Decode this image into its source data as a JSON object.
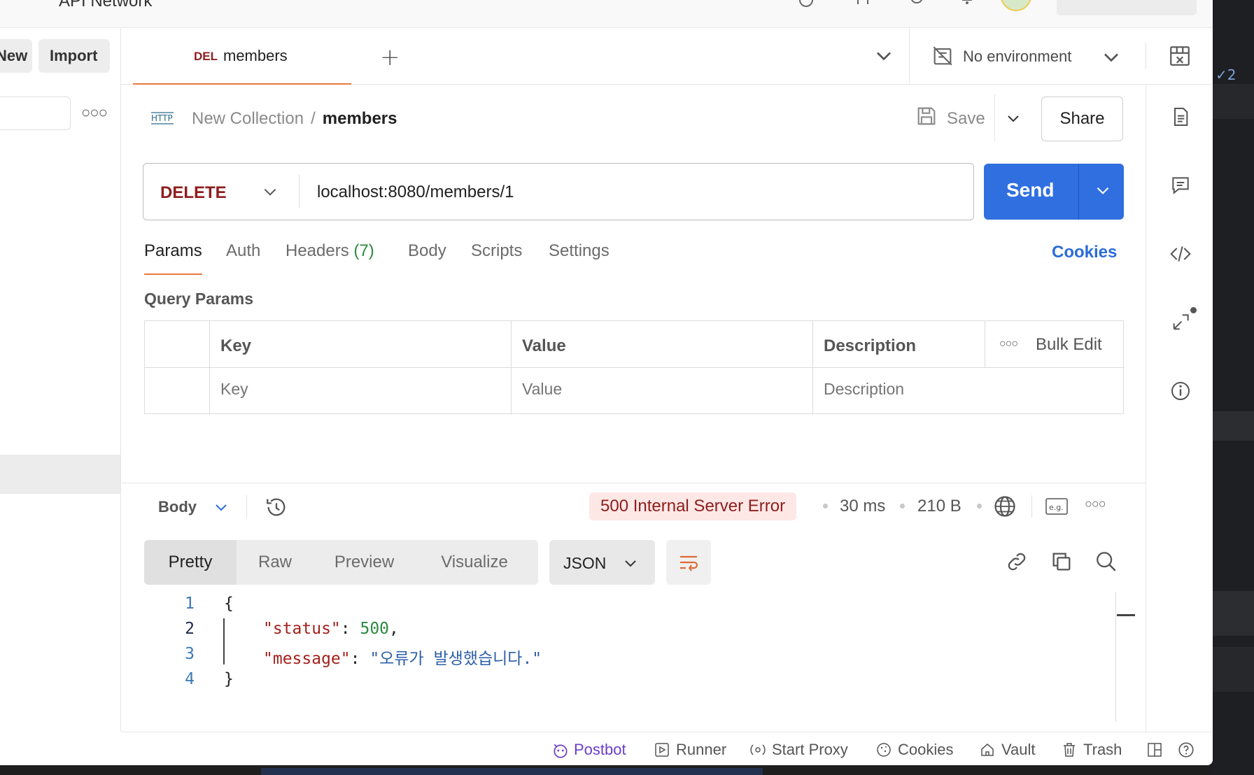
{
  "titlebar": {
    "app_title": "API Network"
  },
  "sidebar": {
    "new_label": "New",
    "import_label": "Import"
  },
  "tab": {
    "method": "DEL",
    "name": "members"
  },
  "environment": {
    "label": "No environment"
  },
  "breadcrumb": {
    "collection": "New Collection",
    "separator": "/",
    "request": "members"
  },
  "actions": {
    "save_label": "Save",
    "share_label": "Share"
  },
  "request": {
    "method": "DELETE",
    "url": "localhost:8080/members/1",
    "send_label": "Send"
  },
  "request_tabs": {
    "params": "Params",
    "auth": "Auth",
    "headers": "Headers",
    "headers_count": "(7)",
    "body": "Body",
    "scripts": "Scripts",
    "settings": "Settings",
    "cookies": "Cookies"
  },
  "query_params": {
    "title": "Query Params",
    "headers": {
      "key": "Key",
      "value": "Value",
      "description": "Description",
      "bulk_edit": "Bulk Edit"
    },
    "placeholders": {
      "key": "Key",
      "value": "Value",
      "description": "Description"
    }
  },
  "response": {
    "section_label": "Body",
    "status": "500 Internal Server Error",
    "time": "30 ms",
    "size": "210 B",
    "views": [
      "Pretty",
      "Raw",
      "Preview",
      "Visualize"
    ],
    "active_view": "Pretty",
    "format": "JSON",
    "code_lines": [
      {
        "num": "1",
        "text": "{"
      },
      {
        "num": "2",
        "key": "\"status\"",
        "sep": ": ",
        "value": "500",
        "tail": ","
      },
      {
        "num": "3",
        "key": "\"message\"",
        "sep": ": ",
        "value": "\"오류가 발생했습니다.\""
      },
      {
        "num": "4",
        "text": "}"
      }
    ]
  },
  "footer": {
    "postbot": "Postbot",
    "runner": "Runner",
    "start_proxy": "Start Proxy",
    "cookies": "Cookies",
    "vault": "Vault",
    "trash": "Trash"
  },
  "editor_strip": {
    "git_count": "✓2"
  },
  "colors": {
    "accent_orange": "#e87a3d",
    "send_blue": "#2f6fdf",
    "method_red": "#8f1d1d",
    "error_bg": "#fde8e6",
    "link_blue": "#2b6cd6"
  }
}
